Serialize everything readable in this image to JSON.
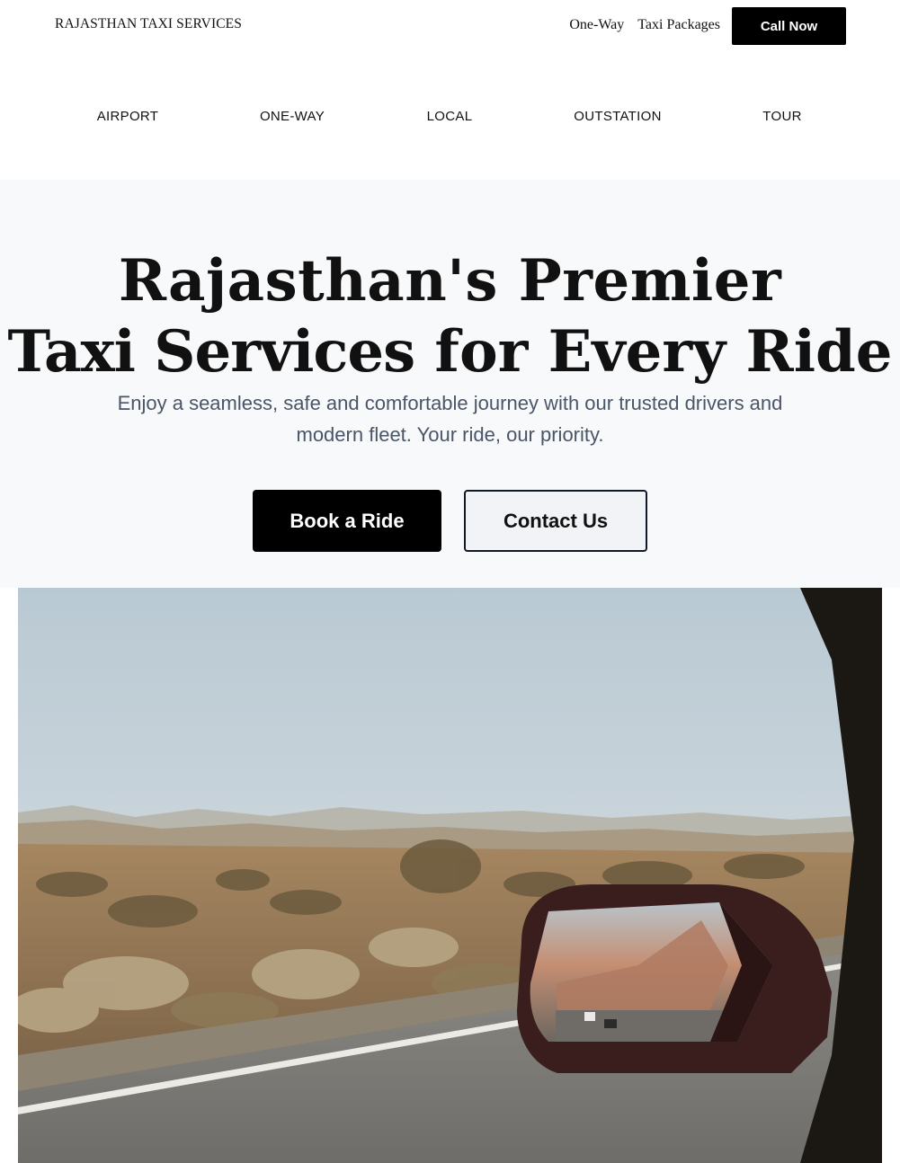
{
  "header": {
    "brand": "RAJASTHAN TAXI SERVICES",
    "links": [
      "One-Way",
      "Taxi Packages"
    ],
    "cta": "Call Now"
  },
  "categories": [
    "AIRPORT",
    "ONE-WAY",
    "LOCAL",
    "OUTSTATION",
    "TOUR"
  ],
  "hero": {
    "line1": "Rajasthan's Premier",
    "line2_bold": "Taxi Services",
    "line2_rest": " for Every Ride",
    "subtitle": "Enjoy a seamless, safe and comfortable journey with our trusted drivers and modern fleet. Your ride, our priority.",
    "primary_button": "Book a Ride",
    "secondary_button": "Contact Us"
  },
  "image": {
    "subject": "desert-road-side-mirror-photo"
  },
  "colors": {
    "button_primary": "#000000",
    "hero_background": "#f8f9fa",
    "subtitle_text": "#4a5568"
  }
}
